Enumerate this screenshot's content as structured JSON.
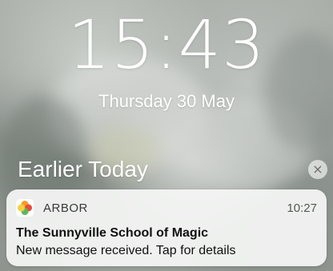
{
  "lockscreen": {
    "time": "15:43",
    "date": "Thursday 30 May"
  },
  "notifications": {
    "section_title": "Earlier Today",
    "clear_label": "×",
    "items": [
      {
        "app_name": "ARBOR",
        "app_icon": "arbor-app-icon",
        "time": "10:27",
        "title": "The Sunnyville School of Magic",
        "body": "New message received. Tap for details"
      }
    ]
  },
  "colors": {
    "text_on_wallpaper": "#ffffff",
    "card_background": "#f5f6f5",
    "icon_orange": "#f39c2a",
    "icon_green": "#5cb85c",
    "icon_red": "#e74c3c",
    "icon_yellow": "#f4d03f"
  }
}
